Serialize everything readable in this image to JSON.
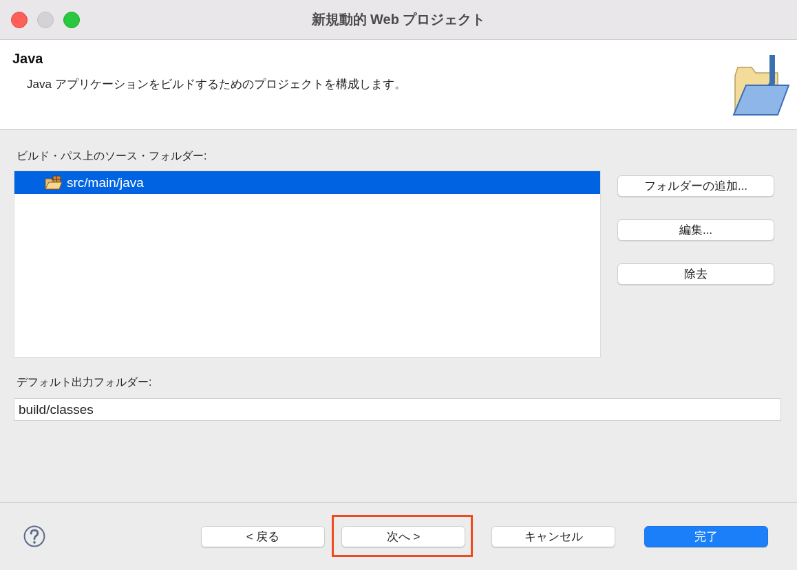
{
  "window": {
    "title": "新規動的 Web プロジェクト"
  },
  "header": {
    "title": "Java",
    "description": "Java アプリケーションをビルドするためのプロジェクトを構成します。"
  },
  "source_folders": {
    "label": "ビルド・パス上のソース・フォルダー:",
    "items": [
      {
        "label": "src/main/java",
        "selected": true
      }
    ]
  },
  "side_buttons": [
    "フォルダーの追加...",
    "編集...",
    "除去"
  ],
  "output_folder": {
    "label": "デフォルト出力フォルダー:",
    "value": "build/classes"
  },
  "footer_buttons": [
    {
      "label": "< 戻る",
      "kind": "normal",
      "highlighted": false
    },
    {
      "label": "次へ >",
      "kind": "normal",
      "highlighted": true
    },
    {
      "label": "キャンセル",
      "kind": "normal",
      "highlighted": false
    },
    {
      "label": "完了",
      "kind": "default",
      "highlighted": false
    }
  ]
}
